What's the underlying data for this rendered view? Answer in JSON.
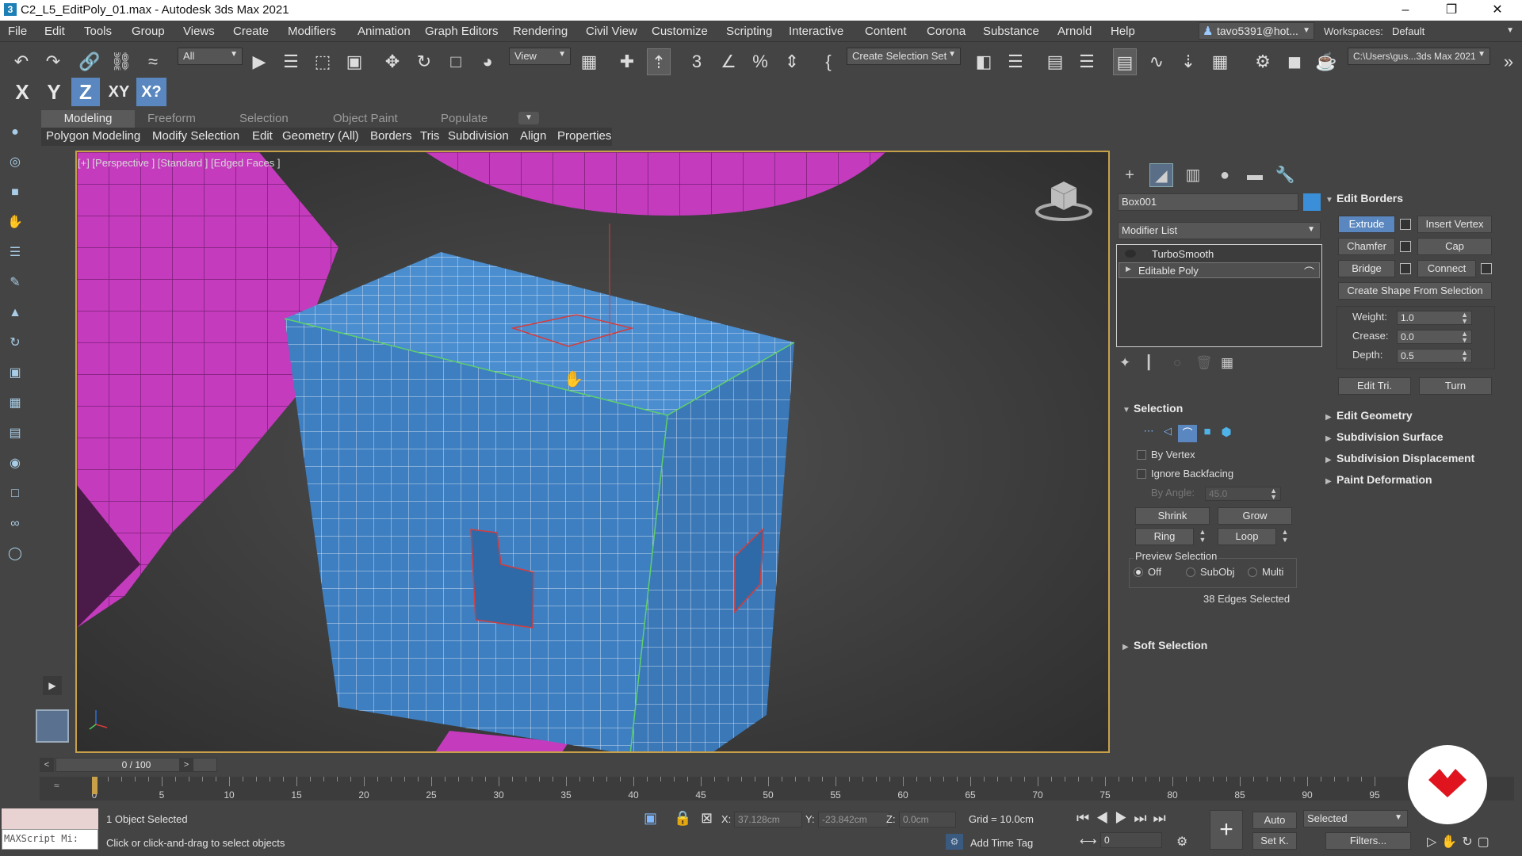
{
  "window": {
    "title": "C2_L5_EditPoly_01.max - Autodesk 3ds Max 2021",
    "icon": "3",
    "controls": [
      "–",
      "❐",
      "✕"
    ]
  },
  "menu": [
    "File",
    "Edit",
    "Tools",
    "Group",
    "Views",
    "Create",
    "Modifiers",
    "Animation",
    "Graph Editors",
    "Rendering",
    "Civil View",
    "Customize",
    "Scripting",
    "Interactive",
    "Content",
    "Corona",
    "Substance",
    "Arnold",
    "Help"
  ],
  "account": {
    "user": "tavo5391@hot...",
    "workspaces_label": "Workspaces:",
    "workspace": "Default"
  },
  "toolbar": {
    "filter": "All",
    "ref_coord": "View",
    "selection_set_placeholder": "Create Selection Set",
    "project_path": "C:\\Users\\gus...3ds Max 2021"
  },
  "axis_constraints": [
    "X",
    "Y",
    "Z",
    "XY",
    "X?"
  ],
  "active_axis": "Z",
  "ribbon": {
    "tabs": [
      "Modeling",
      "Freeform",
      "Selection",
      "Object Paint",
      "Populate"
    ],
    "active_tab": "Modeling",
    "subtabs": [
      "Polygon Modeling",
      "Modify Selection",
      "Edit",
      "Geometry (All)",
      "Borders",
      "Tris",
      "Subdivision",
      "Align",
      "Properties"
    ]
  },
  "viewport": {
    "label": "[+] [Perspective ] [Standard ] [Edged Faces ]"
  },
  "command_panel": {
    "object_name": "Box001",
    "object_color": "#3a8fd8",
    "modifier_list_label": "Modifier List",
    "stack": [
      "TurboSmooth",
      "Editable Poly"
    ],
    "edit_borders": {
      "title": "Edit Borders",
      "extrude": "Extrude",
      "insert_vertex": "Insert Vertex",
      "chamfer": "Chamfer",
      "cap": "Cap",
      "bridge": "Bridge",
      "connect": "Connect",
      "create_shape": "Create Shape From Selection",
      "weight_label": "Weight:",
      "weight": "1.0",
      "crease_label": "Crease:",
      "crease": "0.0",
      "depth_label": "Depth:",
      "depth": "0.5",
      "edit_tri": "Edit Tri.",
      "turn": "Turn"
    },
    "rollouts": [
      "Edit Geometry",
      "Subdivision Surface",
      "Subdivision Displacement",
      "Paint Deformation"
    ],
    "selection": {
      "title": "Selection",
      "by_vertex": "By Vertex",
      "ignore_backfacing": "Ignore Backfacing",
      "by_angle_label": "By Angle:",
      "by_angle": "45.0",
      "shrink": "Shrink",
      "grow": "Grow",
      "ring": "Ring",
      "loop": "Loop",
      "preview_label": "Preview Selection",
      "preview_off": "Off",
      "preview_subobj": "SubObj",
      "preview_multi": "Multi",
      "status": "38 Edges Selected"
    },
    "soft_selection": "Soft Selection"
  },
  "timeline": {
    "frame": "0 / 100",
    "ticks": [
      "0",
      "5",
      "10",
      "15",
      "20",
      "25",
      "30",
      "35",
      "40",
      "45",
      "50",
      "55",
      "60",
      "65",
      "70",
      "75",
      "80",
      "85",
      "90",
      "95"
    ]
  },
  "status": {
    "maxscript": "MAXScript Mi:",
    "selected": "1 Object Selected",
    "prompt": "Click or click-and-drag to select objects",
    "x_label": "X:",
    "x": "37.128cm",
    "y_label": "Y:",
    "y": "-23.842cm",
    "z_label": "Z:",
    "z": "0.0cm",
    "grid": "Grid = 10.0cm",
    "add_time_tag": "Add Time Tag",
    "auto": "Auto",
    "set_key": "Set K.",
    "selected_dd": "Selected",
    "filters": "Filters...",
    "frame_field": "0"
  },
  "colors": {
    "accent_blue": "#5a87bf",
    "mesh_blue": "#3e7fc1",
    "mesh_magenta": "#c43bbd",
    "viewport_border": "#c7a049",
    "logo_red": "#e0141e"
  }
}
